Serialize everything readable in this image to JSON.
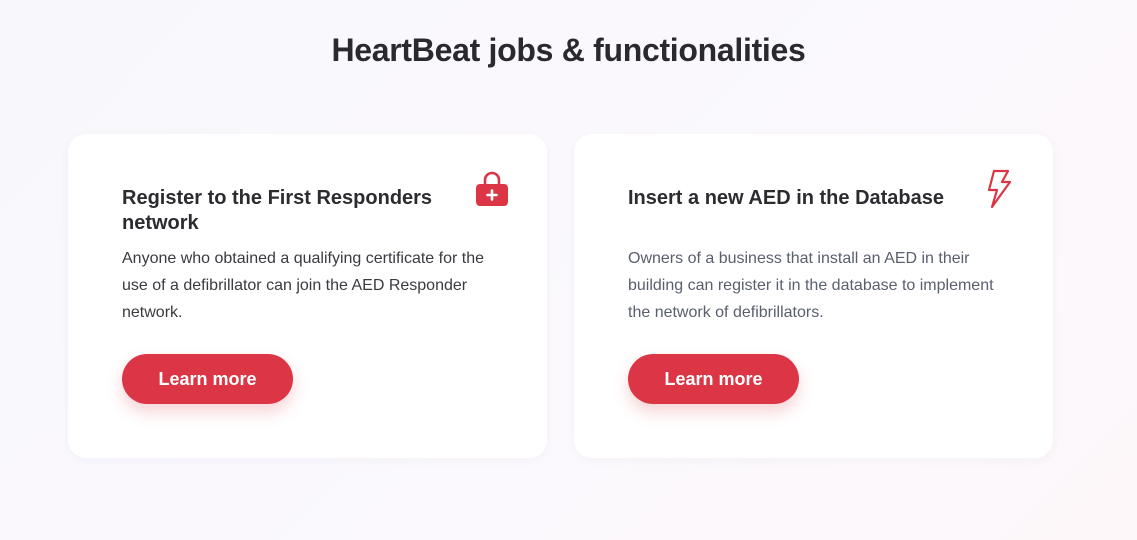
{
  "page": {
    "title": "HeartBeat jobs & functionalities"
  },
  "theme": {
    "accent": "#dc3545",
    "heading_color": "#2a2a2e"
  },
  "cards": [
    {
      "icon": "shopping-bag-plus-icon",
      "title": "Register to the First Responders network",
      "description": "Anyone who obtained a qualifying certificate for the use of a defibrillator can join the AED Responder network.",
      "button_label": "Learn more"
    },
    {
      "icon": "lightning-bolt-icon",
      "title": "Insert a new AED in the Database",
      "description": "Owners of a business that install an AED in their building can register it in the database to implement the network of defibrillators.",
      "button_label": "Learn more"
    }
  ]
}
